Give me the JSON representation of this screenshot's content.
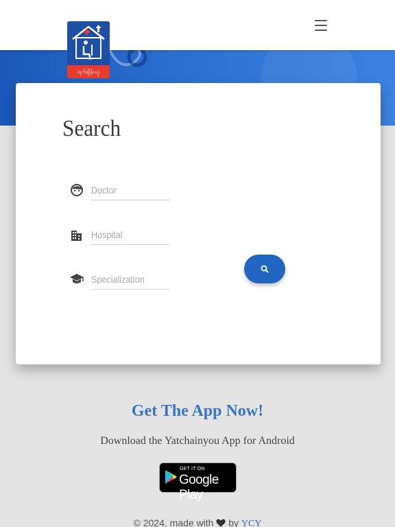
{
  "header": {
    "logo_icon": "clinic-house-logo-icon",
    "logo_caption": "ရက်ချိန်းယူ",
    "menu_icon": "hamburger-menu-icon"
  },
  "search_card": {
    "title": "Search",
    "fields": [
      {
        "icon": "face-icon",
        "placeholder": "Doctor",
        "value": ""
      },
      {
        "icon": "building-icon",
        "placeholder": "Hospital",
        "value": ""
      },
      {
        "icon": "graduation-cap-icon",
        "placeholder": "Specialization",
        "value": ""
      }
    ],
    "search_button_icon": "search-icon"
  },
  "app_promo": {
    "title": "Get The App Now!",
    "subtitle": "Download the Yatchainyou App for Android",
    "badge_small": "GET IT ON",
    "badge_big": "Google Play"
  },
  "footer": {
    "prefix": "© 2024, made with",
    "by": "by",
    "link": "YCY"
  },
  "colors": {
    "hero_blue": "#2c6fd0",
    "accent_blue": "#2266c2",
    "title_blue": "#3a76c7",
    "logo_red": "#e63b2e"
  }
}
